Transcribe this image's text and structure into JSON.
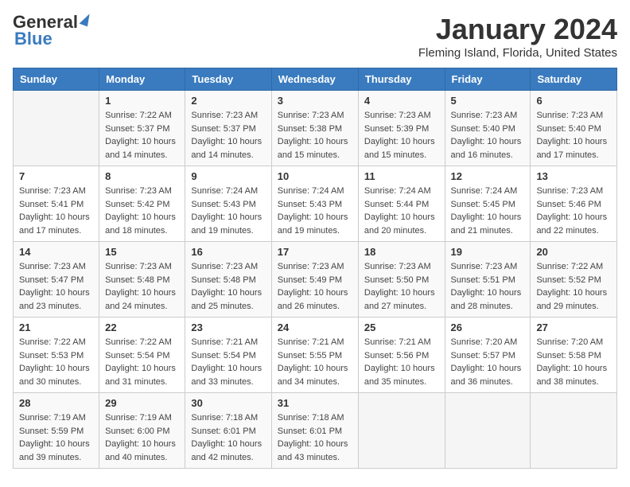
{
  "header": {
    "logo_general": "General",
    "logo_blue": "Blue",
    "title": "January 2024",
    "subtitle": "Fleming Island, Florida, United States"
  },
  "days_of_week": [
    "Sunday",
    "Monday",
    "Tuesday",
    "Wednesday",
    "Thursday",
    "Friday",
    "Saturday"
  ],
  "weeks": [
    [
      {
        "day": "",
        "info": ""
      },
      {
        "day": "1",
        "info": "Sunrise: 7:22 AM\nSunset: 5:37 PM\nDaylight: 10 hours\nand 14 minutes."
      },
      {
        "day": "2",
        "info": "Sunrise: 7:23 AM\nSunset: 5:37 PM\nDaylight: 10 hours\nand 14 minutes."
      },
      {
        "day": "3",
        "info": "Sunrise: 7:23 AM\nSunset: 5:38 PM\nDaylight: 10 hours\nand 15 minutes."
      },
      {
        "day": "4",
        "info": "Sunrise: 7:23 AM\nSunset: 5:39 PM\nDaylight: 10 hours\nand 15 minutes."
      },
      {
        "day": "5",
        "info": "Sunrise: 7:23 AM\nSunset: 5:40 PM\nDaylight: 10 hours\nand 16 minutes."
      },
      {
        "day": "6",
        "info": "Sunrise: 7:23 AM\nSunset: 5:40 PM\nDaylight: 10 hours\nand 17 minutes."
      }
    ],
    [
      {
        "day": "7",
        "info": "Sunrise: 7:23 AM\nSunset: 5:41 PM\nDaylight: 10 hours\nand 17 minutes."
      },
      {
        "day": "8",
        "info": "Sunrise: 7:23 AM\nSunset: 5:42 PM\nDaylight: 10 hours\nand 18 minutes."
      },
      {
        "day": "9",
        "info": "Sunrise: 7:24 AM\nSunset: 5:43 PM\nDaylight: 10 hours\nand 19 minutes."
      },
      {
        "day": "10",
        "info": "Sunrise: 7:24 AM\nSunset: 5:43 PM\nDaylight: 10 hours\nand 19 minutes."
      },
      {
        "day": "11",
        "info": "Sunrise: 7:24 AM\nSunset: 5:44 PM\nDaylight: 10 hours\nand 20 minutes."
      },
      {
        "day": "12",
        "info": "Sunrise: 7:24 AM\nSunset: 5:45 PM\nDaylight: 10 hours\nand 21 minutes."
      },
      {
        "day": "13",
        "info": "Sunrise: 7:23 AM\nSunset: 5:46 PM\nDaylight: 10 hours\nand 22 minutes."
      }
    ],
    [
      {
        "day": "14",
        "info": "Sunrise: 7:23 AM\nSunset: 5:47 PM\nDaylight: 10 hours\nand 23 minutes."
      },
      {
        "day": "15",
        "info": "Sunrise: 7:23 AM\nSunset: 5:48 PM\nDaylight: 10 hours\nand 24 minutes."
      },
      {
        "day": "16",
        "info": "Sunrise: 7:23 AM\nSunset: 5:48 PM\nDaylight: 10 hours\nand 25 minutes."
      },
      {
        "day": "17",
        "info": "Sunrise: 7:23 AM\nSunset: 5:49 PM\nDaylight: 10 hours\nand 26 minutes."
      },
      {
        "day": "18",
        "info": "Sunrise: 7:23 AM\nSunset: 5:50 PM\nDaylight: 10 hours\nand 27 minutes."
      },
      {
        "day": "19",
        "info": "Sunrise: 7:23 AM\nSunset: 5:51 PM\nDaylight: 10 hours\nand 28 minutes."
      },
      {
        "day": "20",
        "info": "Sunrise: 7:22 AM\nSunset: 5:52 PM\nDaylight: 10 hours\nand 29 minutes."
      }
    ],
    [
      {
        "day": "21",
        "info": "Sunrise: 7:22 AM\nSunset: 5:53 PM\nDaylight: 10 hours\nand 30 minutes."
      },
      {
        "day": "22",
        "info": "Sunrise: 7:22 AM\nSunset: 5:54 PM\nDaylight: 10 hours\nand 31 minutes."
      },
      {
        "day": "23",
        "info": "Sunrise: 7:21 AM\nSunset: 5:54 PM\nDaylight: 10 hours\nand 33 minutes."
      },
      {
        "day": "24",
        "info": "Sunrise: 7:21 AM\nSunset: 5:55 PM\nDaylight: 10 hours\nand 34 minutes."
      },
      {
        "day": "25",
        "info": "Sunrise: 7:21 AM\nSunset: 5:56 PM\nDaylight: 10 hours\nand 35 minutes."
      },
      {
        "day": "26",
        "info": "Sunrise: 7:20 AM\nSunset: 5:57 PM\nDaylight: 10 hours\nand 36 minutes."
      },
      {
        "day": "27",
        "info": "Sunrise: 7:20 AM\nSunset: 5:58 PM\nDaylight: 10 hours\nand 38 minutes."
      }
    ],
    [
      {
        "day": "28",
        "info": "Sunrise: 7:19 AM\nSunset: 5:59 PM\nDaylight: 10 hours\nand 39 minutes."
      },
      {
        "day": "29",
        "info": "Sunrise: 7:19 AM\nSunset: 6:00 PM\nDaylight: 10 hours\nand 40 minutes."
      },
      {
        "day": "30",
        "info": "Sunrise: 7:18 AM\nSunset: 6:01 PM\nDaylight: 10 hours\nand 42 minutes."
      },
      {
        "day": "31",
        "info": "Sunrise: 7:18 AM\nSunset: 6:01 PM\nDaylight: 10 hours\nand 43 minutes."
      },
      {
        "day": "",
        "info": ""
      },
      {
        "day": "",
        "info": ""
      },
      {
        "day": "",
        "info": ""
      }
    ]
  ]
}
